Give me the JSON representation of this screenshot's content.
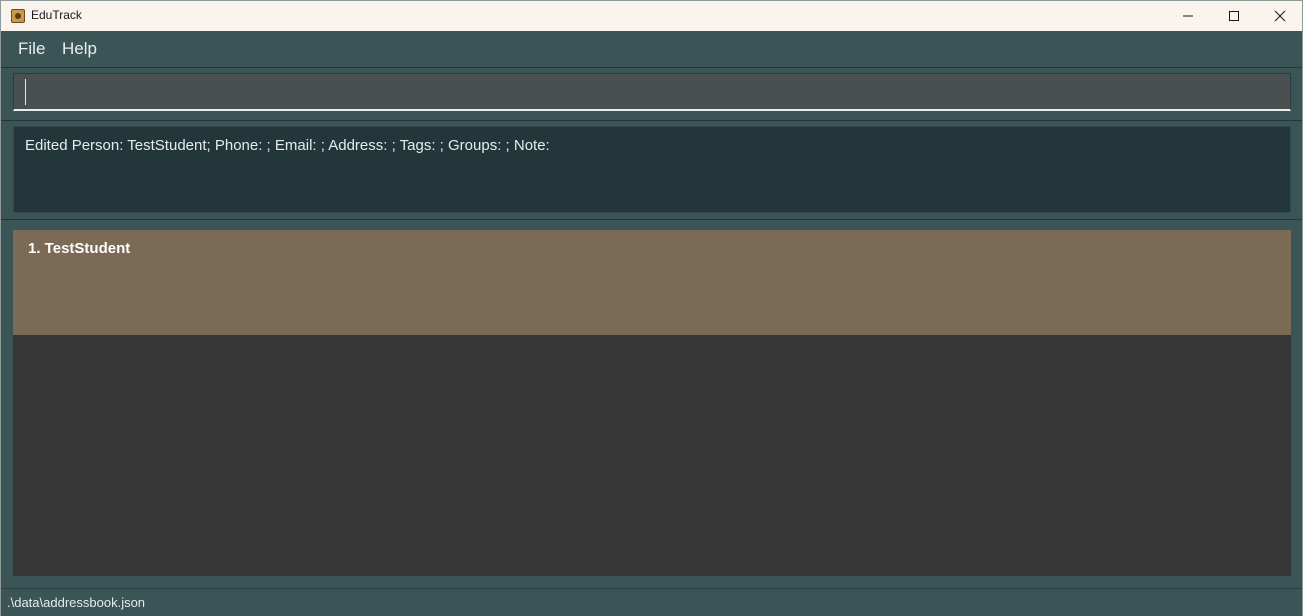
{
  "window": {
    "title": "EduTrack",
    "controls": {
      "minimize_icon": "minimize-icon",
      "maximize_icon": "maximize-icon",
      "close_icon": "close-icon"
    }
  },
  "menu": {
    "items": [
      {
        "label": "File"
      },
      {
        "label": "Help"
      }
    ]
  },
  "command": {
    "value": "",
    "placeholder": ""
  },
  "result": {
    "text": "Edited Person: TestStudent; Phone: ; Email: ; Address: ; Tags: ; Groups: ; Note:"
  },
  "persons": [
    {
      "index_name": "1.  TestStudent"
    }
  ],
  "status": {
    "path": ".\\data\\addressbook.json"
  },
  "colors": {
    "background": "#3b5455",
    "result_background": "#23373a",
    "card_selected": "#7b6a56",
    "list_background": "#363636",
    "titlebar": "#fbf3ee"
  }
}
